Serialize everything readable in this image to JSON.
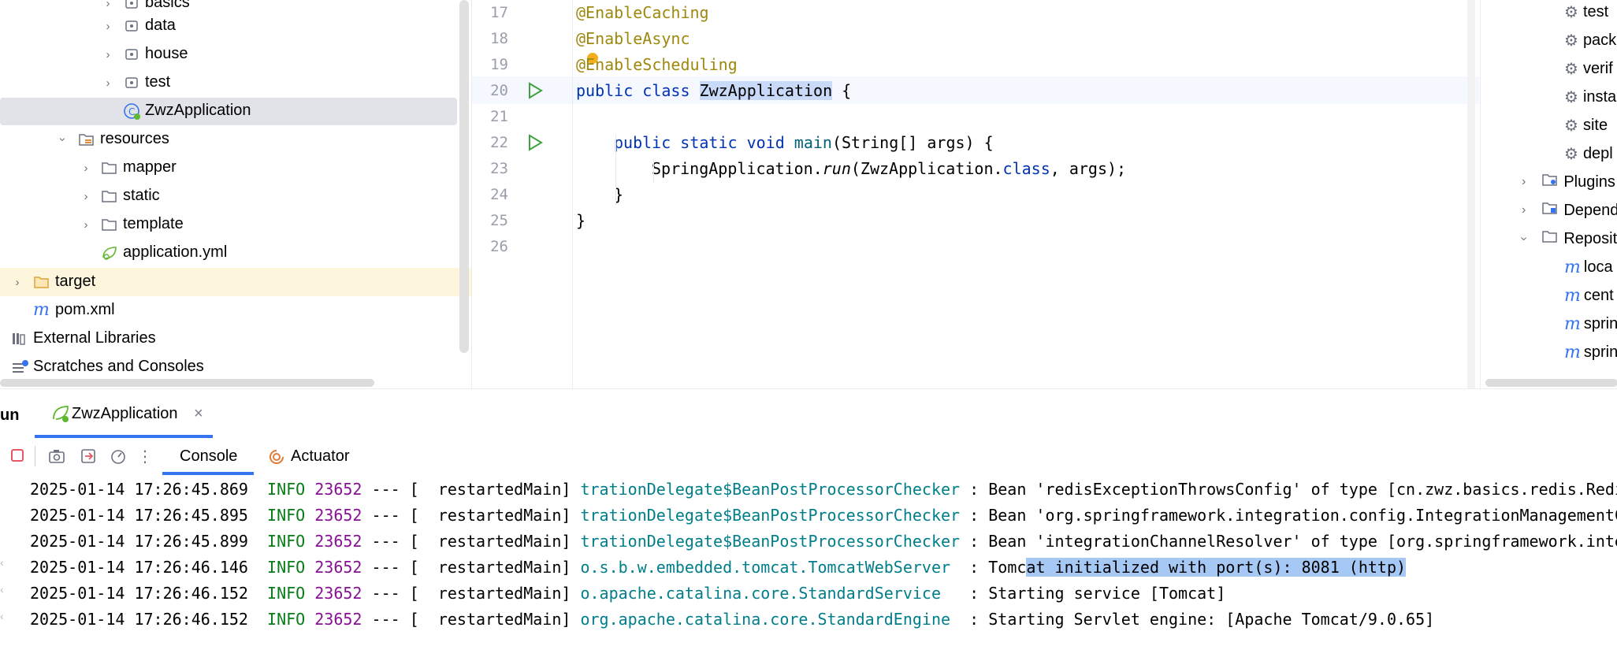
{
  "project_tree": {
    "items": [
      {
        "label": "basics",
        "type": "package"
      },
      {
        "label": "data",
        "type": "package"
      },
      {
        "label": "house",
        "type": "package"
      },
      {
        "label": "test",
        "type": "package"
      },
      {
        "label": "ZwzApplication",
        "type": "spring-class",
        "selected": true
      },
      {
        "label": "resources",
        "type": "resources-folder"
      },
      {
        "label": "mapper",
        "type": "folder"
      },
      {
        "label": "static",
        "type": "folder"
      },
      {
        "label": "template",
        "type": "folder"
      },
      {
        "label": "application.yml",
        "type": "yml-file"
      },
      {
        "label": "target",
        "type": "excluded-folder"
      },
      {
        "label": "pom.xml",
        "type": "maven-file"
      },
      {
        "label": "External Libraries",
        "type": "libraries"
      },
      {
        "label": "Scratches and Consoles",
        "type": "scratches"
      }
    ]
  },
  "editor": {
    "lines": [
      {
        "num": "17",
        "text": "@EnableCaching"
      },
      {
        "num": "18",
        "text": "@EnableAsync"
      },
      {
        "num": "19",
        "text": "@EnableScheduling"
      },
      {
        "num": "20",
        "kw": "public class",
        "cls": "ZwzApplication",
        "rest": " {"
      },
      {
        "num": "21",
        "text": ""
      },
      {
        "num": "22",
        "kw": "public static void",
        "name": "main",
        "rest": "(String[] args) {"
      },
      {
        "num": "23",
        "pre": "SpringApplication.",
        "call": "run",
        "mid": "(ZwzApplication.",
        "kw": "class",
        "rest": ", args);"
      },
      {
        "num": "24",
        "text": "}"
      },
      {
        "num": "25",
        "text": "}"
      },
      {
        "num": "26",
        "text": ""
      }
    ]
  },
  "maven_panel": {
    "items": [
      {
        "label": "test",
        "type": "lifecycle"
      },
      {
        "label": "pack",
        "type": "lifecycle"
      },
      {
        "label": "verif",
        "type": "lifecycle"
      },
      {
        "label": "insta",
        "type": "lifecycle"
      },
      {
        "label": "site",
        "type": "lifecycle"
      },
      {
        "label": "depl",
        "type": "lifecycle"
      },
      {
        "label": "Plugins",
        "type": "group"
      },
      {
        "label": "Depend",
        "type": "group"
      },
      {
        "label": "Reposit",
        "type": "group"
      },
      {
        "label": "loca",
        "type": "repo"
      },
      {
        "label": "cent",
        "type": "repo"
      },
      {
        "label": "sprin",
        "type": "repo"
      },
      {
        "label": "sprin",
        "type": "repo"
      }
    ]
  },
  "run_window": {
    "title_fragment": "un",
    "tab_label": "ZwzApplication",
    "tabs": [
      "Console",
      "Actuator"
    ],
    "log_lines": [
      {
        "date": "2025-01-14 17:26:45.869",
        "level": "INFO",
        "pid": "23652",
        "sep": "--- [",
        "thread": "  restartedMain]",
        "logger": "trationDelegate$BeanPostProcessorChecker",
        "msg": ": Bean 'redisExceptionThrowsConfig' of type [cn.zwz.basics.redis.Redi"
      },
      {
        "date": "2025-01-14 17:26:45.895",
        "level": "INFO",
        "pid": "23652",
        "sep": "--- [",
        "thread": "  restartedMain]",
        "logger": "trationDelegate$BeanPostProcessorChecker",
        "msg": ": Bean 'org.springframework.integration.config.IntegrationManagementC"
      },
      {
        "date": "2025-01-14 17:26:45.899",
        "level": "INFO",
        "pid": "23652",
        "sep": "--- [",
        "thread": "  restartedMain]",
        "logger": "trationDelegate$BeanPostProcessorChecker",
        "msg": ": Bean 'integrationChannelResolver' of type [org.springframework.inte"
      },
      {
        "date": "2025-01-14 17:26:46.146",
        "level": "INFO",
        "pid": "23652",
        "sep": "--- [",
        "thread": "  restartedMain]",
        "logger": "o.s.b.w.embedded.tomcat.TomcatWebServer",
        "msg_pre": " : Tomc",
        "msg_sel": "at initialized with port(s): 8081 (http)"
      },
      {
        "date": "2025-01-14 17:26:46.152",
        "level": "INFO",
        "pid": "23652",
        "sep": "--- [",
        "thread": "  restartedMain]",
        "logger": "o.apache.catalina.core.StandardService",
        "msg": "  : Starting service [Tomcat]"
      },
      {
        "date": "2025-01-14 17:26:46.152",
        "level": "INFO",
        "pid": "23652",
        "sep": "--- [",
        "thread": "  restartedMain]",
        "logger": "org.apache.catalina.core.StandardEngine",
        "msg": " : Starting Servlet engine: [Apache Tomcat/9.0.65]"
      }
    ]
  },
  "colors": {
    "selection": "#e1e3e8",
    "highlight_row": "#fdf5dc",
    "accent": "#3574f0"
  }
}
